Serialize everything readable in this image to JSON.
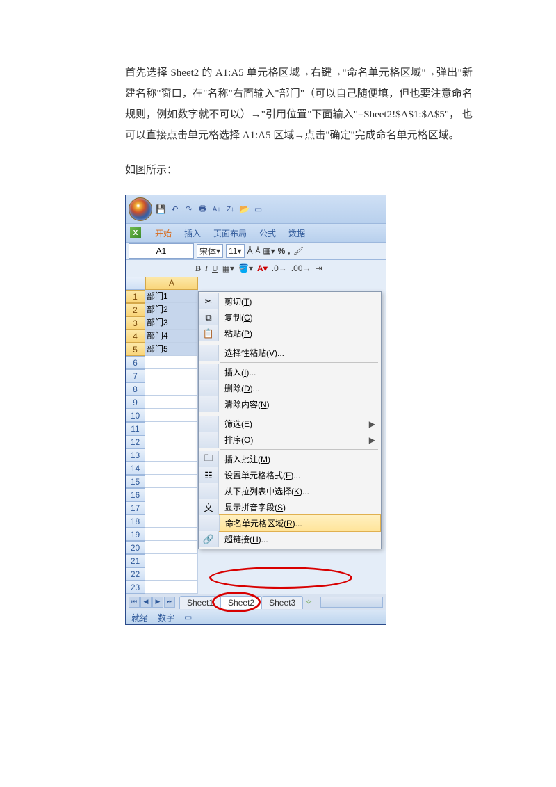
{
  "paragraph": "首先选择 Sheet2 的 A1:A5 单元格区域→右键→\"命名单元格区域\"→弹出\"新建名称\"窗口，在\"名称\"右面输入\"部门\"（可以自己随便填，但也要注意命名规则，例如数字就不可以）→\"引用位置\"下面输入\"=Sheet2!$A$1:$A$5\"， 也可以直接点击单元格选择 A1:A5 区域→点击\"确定\"完成命名单元格区域。",
  "caption": "如图所示：",
  "excel": {
    "ribbonTabs": [
      "开始",
      "插入",
      "页面布局",
      "公式",
      "数据"
    ],
    "nameBox": "A1",
    "font": "宋体",
    "fontSize": "11",
    "colA": "A",
    "rows": [
      1,
      2,
      3,
      4,
      5,
      6,
      7,
      8,
      9,
      10,
      11,
      12,
      13,
      14,
      15,
      16,
      17,
      18,
      19,
      20,
      21,
      22,
      23
    ],
    "cellValues": [
      "部门1",
      "部门2",
      "部门3",
      "部门4",
      "部门5"
    ],
    "sheetTabs": [
      "Sheet1",
      "Sheet2",
      "Sheet3"
    ],
    "status1": "就绪",
    "status2": "数字"
  },
  "context_menu": [
    {
      "icon": "✂",
      "label": "剪切(T)"
    },
    {
      "icon": "⧉",
      "label": "复制(C)"
    },
    {
      "icon": "📋",
      "label": "粘贴(P)"
    },
    {
      "sep": true
    },
    {
      "icon": "",
      "label": "选择性粘贴(V)..."
    },
    {
      "sep": true
    },
    {
      "icon": "",
      "label": "插入(I)..."
    },
    {
      "icon": "",
      "label": "删除(D)..."
    },
    {
      "icon": "",
      "label": "清除内容(N)"
    },
    {
      "sep": true
    },
    {
      "icon": "",
      "label": "筛选(E)",
      "arrow": true
    },
    {
      "icon": "",
      "label": "排序(O)",
      "arrow": true
    },
    {
      "sep": true
    },
    {
      "icon": "🗀",
      "label": "插入批注(M)"
    },
    {
      "icon": "☷",
      "label": "设置单元格格式(F)..."
    },
    {
      "icon": "",
      "label": "从下拉列表中选择(K)..."
    },
    {
      "icon": "文",
      "label": "显示拼音字段(S)"
    },
    {
      "icon": "",
      "label": "命名单元格区域(R)...",
      "hl": true
    },
    {
      "icon": "🔗",
      "label": "超链接(H)..."
    }
  ]
}
